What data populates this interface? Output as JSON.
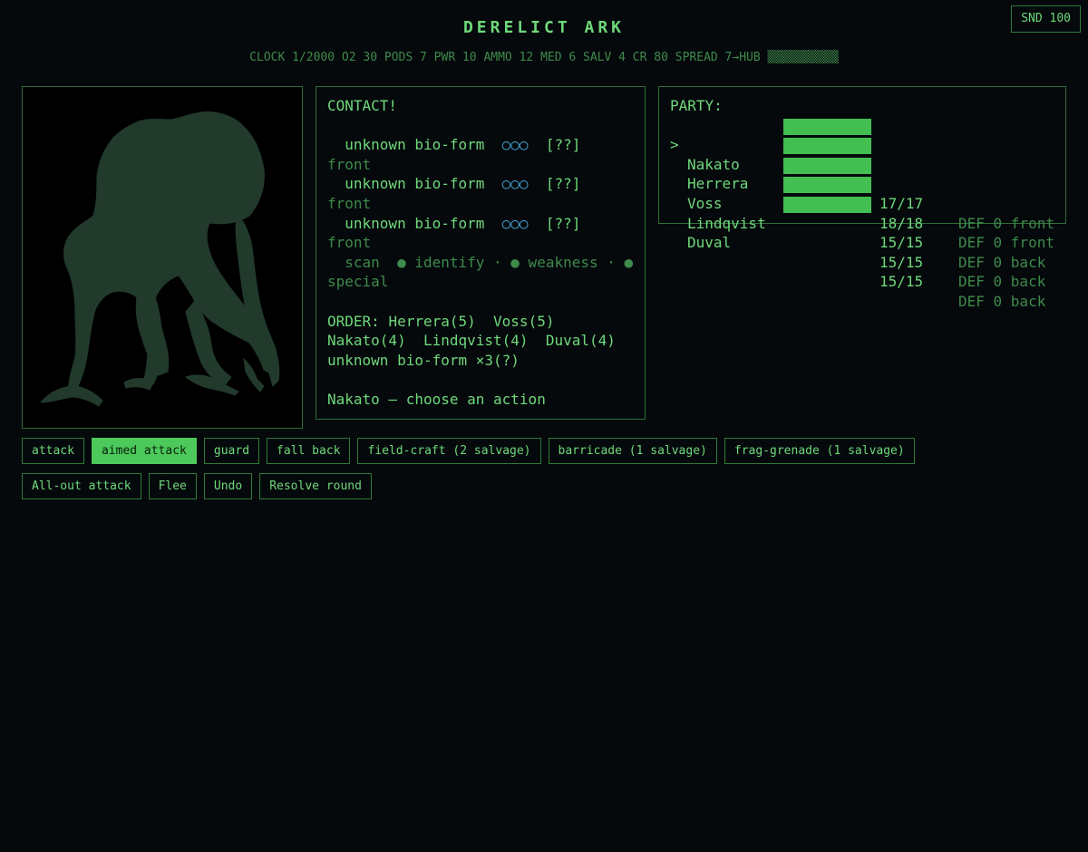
{
  "header": {
    "sound_label": "SND 100",
    "title": "DERELICT ARK",
    "status": "CLOCK 1/2000 O2 30 PODS 7 PWR 10 AMMO 12 MED 6 SALV 4 CR 80 SPREAD 7→HUB",
    "spread_bar": "▒▒▒▒▒▒▒▒▒▒"
  },
  "portrait": {
    "icon": "bio-form-silhouette-icon",
    "fill_color": "#223a2c"
  },
  "combat": {
    "heading": "CONTACT!",
    "enemies": [
      {
        "name": "unknown bio-form",
        "pips": "○○○",
        "hp": "[??]",
        "row": "front"
      },
      {
        "name": "unknown bio-form",
        "pips": "○○○",
        "hp": "[??]",
        "row": "front"
      },
      {
        "name": "unknown bio-form",
        "pips": "○○○",
        "hp": "[??]",
        "row": "front"
      }
    ],
    "scan": "scan  ● identify · ● weakness · ● special",
    "order_label": "ORDER:",
    "order": "Herrera(5)  Voss(5)  Nakato(4)  Lindqvist(4)  Duval(4)  unknown bio-form ×3(?)",
    "prompt": "Nakato — choose an action"
  },
  "party": {
    "heading": "PARTY:",
    "members": [
      {
        "cursor": ">",
        "name": "Nakato",
        "hp": "17/17",
        "hp_fraction": 1.0,
        "def": "DEF 0 front"
      },
      {
        "cursor": "",
        "name": "Herrera",
        "hp": "18/18",
        "hp_fraction": 1.0,
        "def": "DEF 0 front"
      },
      {
        "cursor": "",
        "name": "Voss",
        "hp": "15/15",
        "hp_fraction": 1.0,
        "def": "DEF 0 back"
      },
      {
        "cursor": "",
        "name": "Lindqvist",
        "hp": "15/15",
        "hp_fraction": 1.0,
        "def": "DEF 0 back"
      },
      {
        "cursor": "",
        "name": "Duval",
        "hp": "15/15",
        "hp_fraction": 1.0,
        "def": "DEF 0 back"
      }
    ]
  },
  "actions": {
    "row1": [
      "attack",
      "aimed attack",
      "guard",
      "fall back",
      "field-craft (2 salvage)",
      "barricade (1 salvage)",
      "frag-grenade (1 salvage)"
    ],
    "row1_selected": "aimed attack",
    "row2": [
      "All-out attack",
      "Flee",
      "Undo",
      "Resolve round"
    ]
  },
  "colors": {
    "accent": "#5fcf6a",
    "bright": "#6fd87a",
    "dim": "#3e8a4a",
    "border": "#2f6e37",
    "pips": "#4aa6d8",
    "hp_bar": "#43bf52",
    "background": "#05090c"
  }
}
